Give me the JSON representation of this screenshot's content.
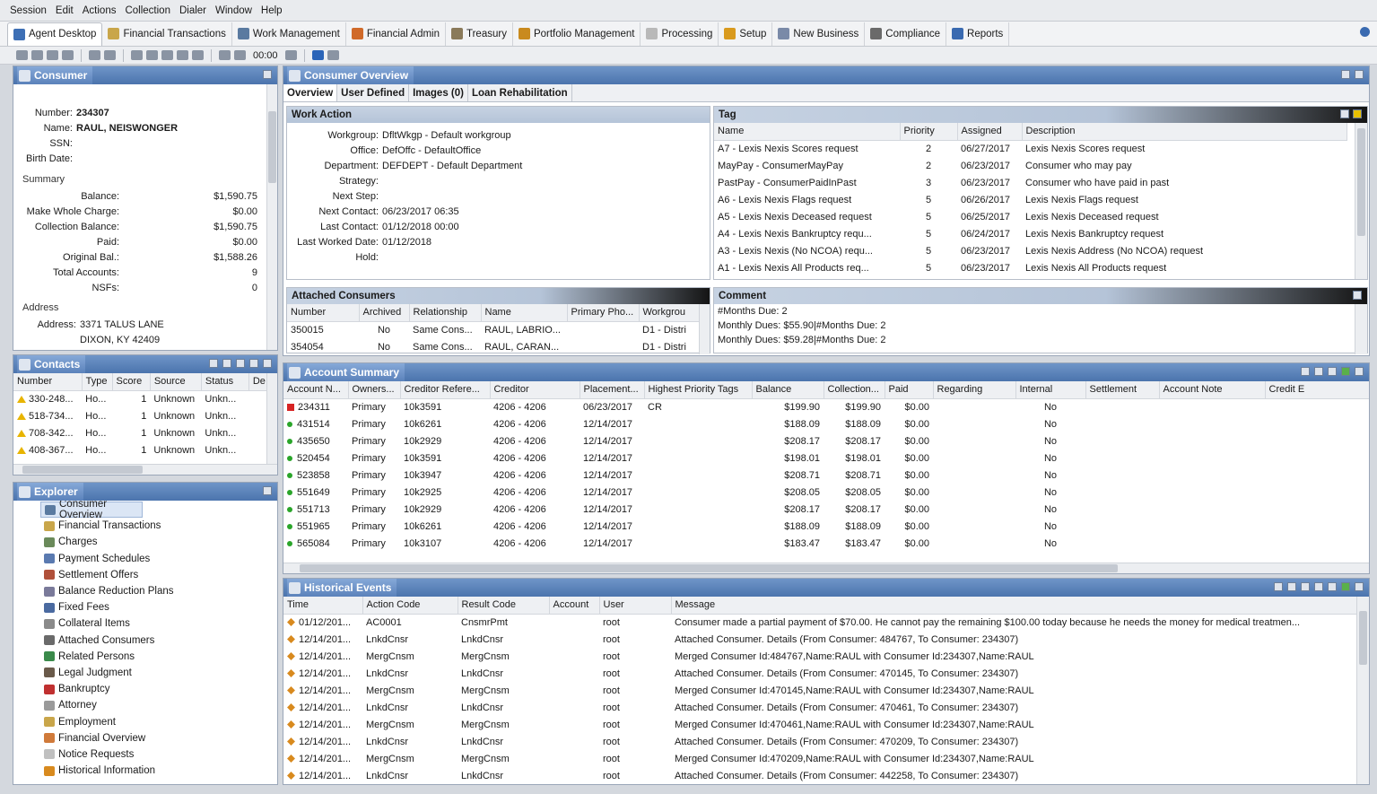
{
  "menu": [
    "Session",
    "Edit",
    "Actions",
    "Collection",
    "Dialer",
    "Window",
    "Help"
  ],
  "modules": [
    {
      "label": "Agent Desktop",
      "icon": "agent-icon",
      "color": "#3d6fb5"
    },
    {
      "label": "Financial Transactions",
      "icon": "financial-icon",
      "color": "#c9a64a"
    },
    {
      "label": "Work Management",
      "icon": "work-icon",
      "color": "#5a7aa0"
    },
    {
      "label": "Financial Admin",
      "icon": "admin-icon",
      "color": "#d06a2a"
    },
    {
      "label": "Treasury",
      "icon": "treasury-icon",
      "color": "#8a7a5a"
    },
    {
      "label": "Portfolio Management",
      "icon": "portfolio-icon",
      "color": "#c98a1e"
    },
    {
      "label": "Processing",
      "icon": "processing-icon",
      "color": "#b9b9b9"
    },
    {
      "label": "Setup",
      "icon": "setup-icon",
      "color": "#d99a1e"
    },
    {
      "label": "New Business",
      "icon": "newbiz-icon",
      "color": "#7a8aa8"
    },
    {
      "label": "Compliance",
      "icon": "compliance-icon",
      "color": "#6a6a6a"
    },
    {
      "label": "Reports",
      "icon": "reports-icon",
      "color": "#3a6ab0"
    }
  ],
  "toolbar": {
    "timer": "00:00"
  },
  "consumer": {
    "title": "Consumer",
    "fields": [
      {
        "k": "Number:",
        "v": "234307"
      },
      {
        "k": "Name:",
        "v": "RAUL, NEISWONGER"
      },
      {
        "k": "SSN:",
        "v": ""
      },
      {
        "k": "Birth Date:",
        "v": ""
      }
    ],
    "summary_label": "Summary",
    "summary": [
      {
        "k": "Balance:",
        "v": "$1,590.75"
      },
      {
        "k": "Make Whole Charge:",
        "v": "$0.00"
      },
      {
        "k": "Collection Balance:",
        "v": "$1,590.75"
      },
      {
        "k": "Paid:",
        "v": "$0.00"
      },
      {
        "k": "Original Bal.:",
        "v": "$1,588.26"
      },
      {
        "k": "Total Accounts:",
        "v": "9"
      },
      {
        "k": "NSFs:",
        "v": "0"
      }
    ],
    "address_label": "Address",
    "address_key": "Address:",
    "address1": "3371 TALUS LANE",
    "address2": "DIXON, KY 42409"
  },
  "contacts": {
    "title": "Contacts",
    "columns": [
      "Number",
      "Type",
      "Score",
      "Source",
      "Status",
      "De"
    ],
    "rows": [
      [
        "330-248...",
        "Ho...",
        "1",
        "Unknown",
        "Unkn..."
      ],
      [
        "518-734...",
        "Ho...",
        "1",
        "Unknown",
        "Unkn..."
      ],
      [
        "708-342...",
        "Ho...",
        "1",
        "Unknown",
        "Unkn..."
      ],
      [
        "408-367...",
        "Ho...",
        "1",
        "Unknown",
        "Unkn..."
      ]
    ]
  },
  "explorer": {
    "title": "Explorer",
    "items": [
      {
        "label": "Consumer Overview",
        "icon": "magnifier-icon",
        "color": "#5a7aa0"
      },
      {
        "label": "Financial Transactions",
        "icon": "financial-icon",
        "color": "#c9a64a"
      },
      {
        "label": "Charges",
        "icon": "charges-icon",
        "color": "#6a8a5a"
      },
      {
        "label": "Payment Schedules",
        "icon": "schedule-icon",
        "color": "#5a7ab0"
      },
      {
        "label": "Settlement Offers",
        "icon": "settlement-icon",
        "color": "#b0503a"
      },
      {
        "label": "Balance Reduction Plans",
        "icon": "reduction-icon",
        "color": "#7a7a9a"
      },
      {
        "label": "Fixed Fees",
        "icon": "fees-icon",
        "color": "#4a6aa0"
      },
      {
        "label": "Collateral Items",
        "icon": "collateral-icon",
        "color": "#8a8a8a"
      },
      {
        "label": "Attached Consumers",
        "icon": "attached-icon",
        "color": "#6a6a6a"
      },
      {
        "label": "Related Persons",
        "icon": "persons-icon",
        "color": "#3a8a4a"
      },
      {
        "label": "Legal Judgment",
        "icon": "legal-icon",
        "color": "#6a5a4a"
      },
      {
        "label": "Bankruptcy",
        "icon": "bankruptcy-icon",
        "color": "#c03030"
      },
      {
        "label": "Attorney",
        "icon": "attorney-icon",
        "color": "#9a9a9a"
      },
      {
        "label": "Employment",
        "icon": "employment-icon",
        "color": "#c9a64a"
      },
      {
        "label": "Financial Overview",
        "icon": "fin-overview-icon",
        "color": "#d07a3a"
      },
      {
        "label": "Notice Requests",
        "icon": "notice-icon",
        "color": "#c0c0c0"
      },
      {
        "label": "Historical Information",
        "icon": "history-icon",
        "color": "#d88a1e"
      }
    ]
  },
  "overview": {
    "title": "Consumer Overview",
    "tabs": [
      "Overview",
      "User Defined",
      "Images (0)",
      "Loan Rehabilitation"
    ],
    "work_action": {
      "title": "Work Action",
      "fields": [
        {
          "k": "Workgroup:",
          "v": "DfltWkgp - Default workgroup"
        },
        {
          "k": "Office:",
          "v": "DefOffc - DefaultOffice"
        },
        {
          "k": "Department:",
          "v": "DEFDEPT - Default Department"
        },
        {
          "k": "Strategy:",
          "v": ""
        },
        {
          "k": "Next Step:",
          "v": ""
        },
        {
          "k": "Next Contact:",
          "v": "06/23/2017 06:35"
        },
        {
          "k": "Last Contact:",
          "v": "01/12/2018 00:00"
        },
        {
          "k": "Last Worked Date:",
          "v": "01/12/2018"
        },
        {
          "k": "Hold:",
          "v": ""
        }
      ]
    },
    "tag": {
      "title": "Tag",
      "columns": [
        "Name",
        "Priority",
        "Assigned",
        "Description"
      ],
      "rows": [
        [
          "A7 - Lexis Nexis Scores request",
          "2",
          "06/27/2017",
          "Lexis Nexis Scores request"
        ],
        [
          "MayPay - ConsumerMayPay",
          "2",
          "06/23/2017",
          "Consumer who may pay"
        ],
        [
          "PastPay - ConsumerPaidInPast",
          "3",
          "06/23/2017",
          "Consumer who have paid in past"
        ],
        [
          "A6 - Lexis Nexis Flags request",
          "5",
          "06/26/2017",
          "Lexis Nexis Flags request"
        ],
        [
          "A5 - Lexis Nexis Deceased request",
          "5",
          "06/25/2017",
          "Lexis Nexis Deceased request"
        ],
        [
          "A4 - Lexis Nexis Bankruptcy requ...",
          "5",
          "06/24/2017",
          "Lexis Nexis Bankruptcy request"
        ],
        [
          "A3 - Lexis Nexis (No NCOA) requ...",
          "5",
          "06/23/2017",
          "Lexis Nexis Address (No NCOA) request"
        ],
        [
          "A1 - Lexis Nexis All Products req...",
          "5",
          "06/23/2017",
          "Lexis Nexis All Products request"
        ]
      ]
    },
    "attached": {
      "title": "Attached Consumers",
      "columns": [
        "Number",
        "Archived",
        "Relationship",
        "Name",
        "Primary Pho...",
        "Workgrou"
      ],
      "rows": [
        [
          "350015",
          "No",
          "Same Cons...",
          "RAUL, LABRIO...",
          "",
          "D1 - Distri"
        ],
        [
          "354054",
          "No",
          "Same Cons...",
          "RAUL, CARAN...",
          "",
          "D1 - Distri"
        ]
      ]
    },
    "comment": {
      "title": "Comment",
      "lines": [
        "#Months Due: 2",
        "Monthly Dues: $55.90|#Months Due: 2",
        "Monthly Dues: $59.28|#Months Due: 2"
      ]
    }
  },
  "accounts": {
    "title": "Account Summary",
    "columns": [
      "Account N...",
      "Owners...",
      "Creditor Refere...",
      "Creditor",
      "Placement...",
      "Highest Priority Tags",
      "Balance",
      "Collection...",
      "Paid",
      "Regarding",
      "Internal",
      "Settlement",
      "Account Note",
      "Credit E"
    ],
    "rows": [
      {
        "flag": "red",
        "cells": [
          "234311",
          "Primary",
          "10k3591",
          "4206 - 4206",
          "06/23/2017",
          "CR",
          "$199.90",
          "$199.90",
          "$0.00",
          "",
          "No",
          "",
          ""
        ]
      },
      {
        "flag": "green",
        "cells": [
          "431514",
          "Primary",
          "10k6261",
          "4206 - 4206",
          "12/14/2017",
          "",
          "$188.09",
          "$188.09",
          "$0.00",
          "",
          "No",
          "",
          ""
        ]
      },
      {
        "flag": "green",
        "cells": [
          "435650",
          "Primary",
          "10k2929",
          "4206 - 4206",
          "12/14/2017",
          "",
          "$208.17",
          "$208.17",
          "$0.00",
          "",
          "No",
          "",
          ""
        ]
      },
      {
        "flag": "green",
        "cells": [
          "520454",
          "Primary",
          "10k3591",
          "4206 - 4206",
          "12/14/2017",
          "",
          "$198.01",
          "$198.01",
          "$0.00",
          "",
          "No",
          "",
          ""
        ]
      },
      {
        "flag": "green",
        "cells": [
          "523858",
          "Primary",
          "10k3947",
          "4206 - 4206",
          "12/14/2017",
          "",
          "$208.71",
          "$208.71",
          "$0.00",
          "",
          "No",
          "",
          ""
        ]
      },
      {
        "flag": "green",
        "cells": [
          "551649",
          "Primary",
          "10k2925",
          "4206 - 4206",
          "12/14/2017",
          "",
          "$208.05",
          "$208.05",
          "$0.00",
          "",
          "No",
          "",
          ""
        ]
      },
      {
        "flag": "green",
        "cells": [
          "551713",
          "Primary",
          "10k2929",
          "4206 - 4206",
          "12/14/2017",
          "",
          "$208.17",
          "$208.17",
          "$0.00",
          "",
          "No",
          "",
          ""
        ]
      },
      {
        "flag": "green",
        "cells": [
          "551965",
          "Primary",
          "10k6261",
          "4206 - 4206",
          "12/14/2017",
          "",
          "$188.09",
          "$188.09",
          "$0.00",
          "",
          "No",
          "",
          ""
        ]
      },
      {
        "flag": "green",
        "cells": [
          "565084",
          "Primary",
          "10k3107",
          "4206 - 4206",
          "12/14/2017",
          "",
          "$183.47",
          "$183.47",
          "$0.00",
          "",
          "No",
          "",
          ""
        ]
      }
    ]
  },
  "history": {
    "title": "Historical Events",
    "columns": [
      "Time",
      "Action Code",
      "Result Code",
      "Account",
      "User",
      "Message"
    ],
    "rows": [
      [
        "01/12/201...",
        "AC0001",
        "CnsmrPmt",
        "",
        "root",
        "Consumer made a partial payment of $70.00. He cannot pay the remaining $100.00 today because he needs the money for medical treatmen..."
      ],
      [
        "12/14/201...",
        "LnkdCnsr",
        "LnkdCnsr",
        "",
        "root",
        "Attached Consumer. Details (From Consumer: 484767, To Consumer: 234307)"
      ],
      [
        "12/14/201...",
        "MergCnsm",
        "MergCnsm",
        "",
        "root",
        "Merged Consumer Id:484767,Name:RAUL with Consumer Id:234307,Name:RAUL"
      ],
      [
        "12/14/201...",
        "LnkdCnsr",
        "LnkdCnsr",
        "",
        "root",
        "Attached Consumer. Details (From Consumer: 470145, To Consumer: 234307)"
      ],
      [
        "12/14/201...",
        "MergCnsm",
        "MergCnsm",
        "",
        "root",
        "Merged Consumer Id:470145,Name:RAUL with Consumer Id:234307,Name:RAUL"
      ],
      [
        "12/14/201...",
        "LnkdCnsr",
        "LnkdCnsr",
        "",
        "root",
        "Attached Consumer. Details (From Consumer: 470461, To Consumer: 234307)"
      ],
      [
        "12/14/201...",
        "MergCnsm",
        "MergCnsm",
        "",
        "root",
        "Merged Consumer Id:470461,Name:RAUL with Consumer Id:234307,Name:RAUL"
      ],
      [
        "12/14/201...",
        "LnkdCnsr",
        "LnkdCnsr",
        "",
        "root",
        "Attached Consumer. Details (From Consumer: 470209, To Consumer: 234307)"
      ],
      [
        "12/14/201...",
        "MergCnsm",
        "MergCnsm",
        "",
        "root",
        "Merged Consumer Id:470209,Name:RAUL with Consumer Id:234307,Name:RAUL"
      ],
      [
        "12/14/201...",
        "LnkdCnsr",
        "LnkdCnsr",
        "",
        "root",
        "Attached Consumer. Details (From Consumer: 442258, To Consumer: 234307)"
      ]
    ]
  }
}
